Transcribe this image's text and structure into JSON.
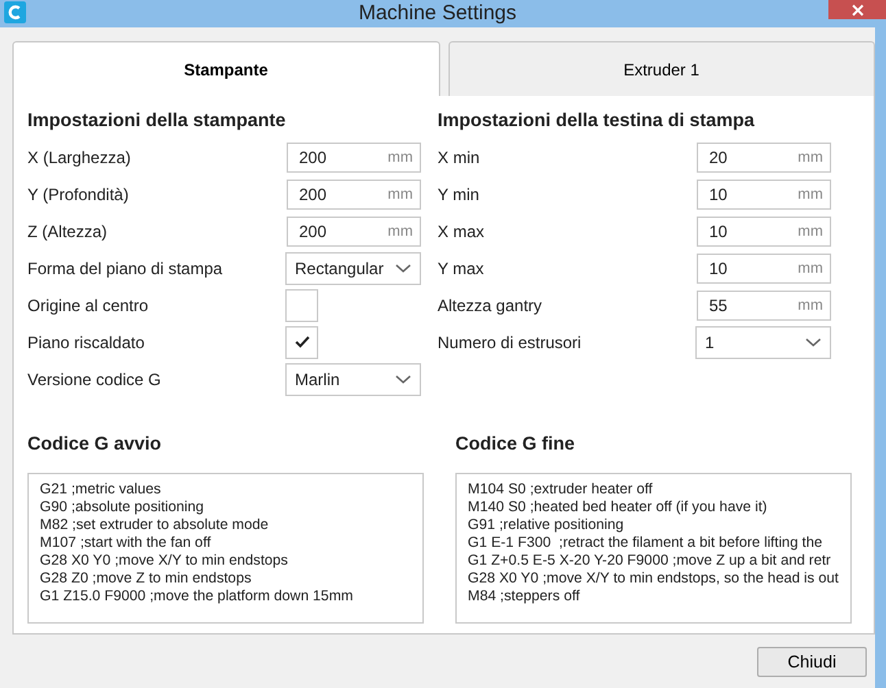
{
  "window": {
    "title": "Machine Settings"
  },
  "tabs": [
    {
      "label": "Stampante",
      "selected": true
    },
    {
      "label": "Extruder 1",
      "selected": false
    }
  ],
  "printer_settings": {
    "heading": "Impostazioni della stampante",
    "fields": [
      {
        "kind": "number",
        "label": "X (Larghezza)",
        "value": "200",
        "unit": "mm"
      },
      {
        "kind": "number",
        "label": "Y (Profondità)",
        "value": "200",
        "unit": "mm"
      },
      {
        "kind": "number",
        "label": "Z (Altezza)",
        "value": "200",
        "unit": "mm"
      },
      {
        "kind": "select",
        "label": "Forma del piano di stampa",
        "value": "Rectangular"
      },
      {
        "kind": "checkbox",
        "label": "Origine al centro",
        "checked": false
      },
      {
        "kind": "checkbox",
        "label": "Piano riscaldato",
        "checked": true
      },
      {
        "kind": "select",
        "label": "Versione codice G",
        "value": "Marlin"
      }
    ]
  },
  "printhead_settings": {
    "heading": "Impostazioni della testina di stampa",
    "fields": [
      {
        "kind": "number",
        "label": "X min",
        "value": "20",
        "unit": "mm"
      },
      {
        "kind": "number",
        "label": "Y min",
        "value": "10",
        "unit": "mm"
      },
      {
        "kind": "number",
        "label": "X max",
        "value": "10",
        "unit": "mm"
      },
      {
        "kind": "number",
        "label": "Y max",
        "value": "10",
        "unit": "mm"
      },
      {
        "kind": "number",
        "label": "Altezza gantry",
        "value": "55",
        "unit": "mm"
      },
      {
        "kind": "select",
        "label": "Numero di estrusori",
        "value": "1"
      }
    ]
  },
  "start_gcode": {
    "heading": "Codice G avvio",
    "lines": [
      "G21 ;metric values",
      "G90 ;absolute positioning",
      "M82 ;set extruder to absolute mode",
      "M107 ;start with the fan off",
      "G28 X0 Y0 ;move X/Y to min endstops",
      "G28 Z0 ;move Z to min endstops",
      "G1 Z15.0 F9000 ;move the platform down 15mm"
    ]
  },
  "end_gcode": {
    "heading": "Codice G fine",
    "lines": [
      "M104 S0 ;extruder heater off",
      "M140 S0 ;heated bed heater off (if you have it)",
      "G91 ;relative positioning",
      "G1 E-1 F300  ;retract the filament a bit before lifting the",
      "G1 Z+0.5 E-5 X-20 Y-20 F9000 ;move Z up a bit and retr",
      "G28 X0 Y0 ;move X/Y to min endstops, so the head is out",
      "M84 ;steppers off"
    ]
  },
  "buttons": [
    "Chiudi"
  ]
}
